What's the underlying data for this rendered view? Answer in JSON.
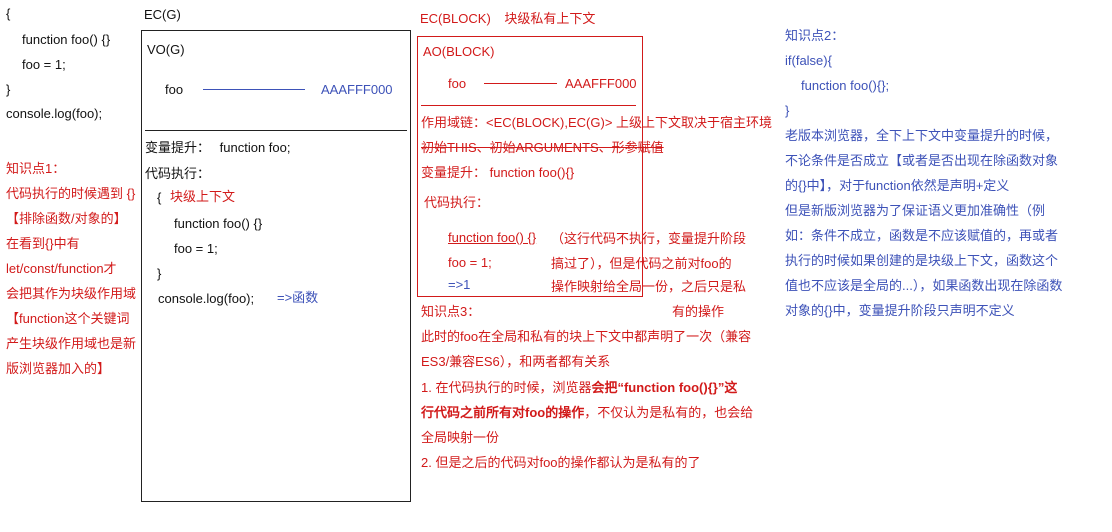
{
  "col1": {
    "code": [
      "{",
      "function foo() {}",
      "foo = 1;",
      "}",
      "console.log(foo);"
    ],
    "note": [
      "知识点1：",
      "代码执行的时候遇到 {}",
      "【排除函数/对象的】",
      "在看到{}中有",
      "let/const/function才",
      "会把其作为块级作用域",
      "【function这个关键词",
      "产生块级作用域也是新",
      "版浏览器加入的】"
    ]
  },
  "ecg": {
    "title": "EC(G)",
    "vo": "VO(G)",
    "foo": "foo",
    "addr": "AAAFFF000",
    "hoist_label": "变量提升：",
    "hoist_value": "function foo;",
    "exec_label": "代码执行：",
    "brace_open": "{",
    "block_label": "块级上下文",
    "line1": "function foo() {}",
    "line2": "foo = 1;",
    "brace_close": "}",
    "log": "console.log(foo);",
    "arrow": "=>函数"
  },
  "ecblock": {
    "title": "EC(BLOCK)",
    "subtitle": "块级私有上下文",
    "ao": "AO(BLOCK)",
    "foo": "foo",
    "addr": "AAAFFF000",
    "scope": "作用域链：<EC(BLOCK),EC(G)>   上级上下文取决于宿主环境",
    "init": "初始THIS、初始ARGUMENTS、形参赋值",
    "hoist": "变量提升：  function foo(){}",
    "exec": "代码执行：",
    "line1": "function foo() {}",
    "line2": "foo = 1;",
    "line3": "=>1",
    "comment": [
      "（这行代码不执行，变量提升阶段",
      "搞过了），但是代码之前对foo的",
      "操作映射给全局一份，之后只是私",
      "有的操作"
    ]
  },
  "note3": {
    "title": "知识点3：",
    "p1": [
      "此时的foo在全局和私有的块上下文中都声明了一次（兼容",
      "ES3/兼容ES6），和两者都有关系"
    ],
    "p2_pre": "1. 在代码执行的时候，浏览器",
    "p2_bold1": "会把“function foo(){}”这",
    "p2_bold2": "行代码之前所有对foo的操作",
    "p2_post": "，不仅认为是私有的，也会给",
    "p2_end": "全局映射一份",
    "p3": "2. 但是之后的代码对foo的操作都认为是私有的了"
  },
  "note2": {
    "title": "知识点2：",
    "code": [
      "if(false){",
      "function foo(){};",
      "}"
    ],
    "lines": [
      "老版本浏览器，全下上下文中变量提升的时候，",
      "不论条件是否成立【或者是否出现在除函数对象",
      "的{}中】，对于function依然是声明+定义",
      "但是新版浏览器为了保证语义更加准确性（例",
      "如：条件不成立，函数是不应该赋值的，再或者",
      "执行的时候如果创建的是块级上下文，函数这个",
      "值也不应该是全局的...），如果函数出现在除函数",
      "对象的{}中，变量提升阶段只声明不定义"
    ]
  },
  "colors": {
    "red": "#d21a1a",
    "blue": "#3d52b8",
    "black": "#111111"
  }
}
